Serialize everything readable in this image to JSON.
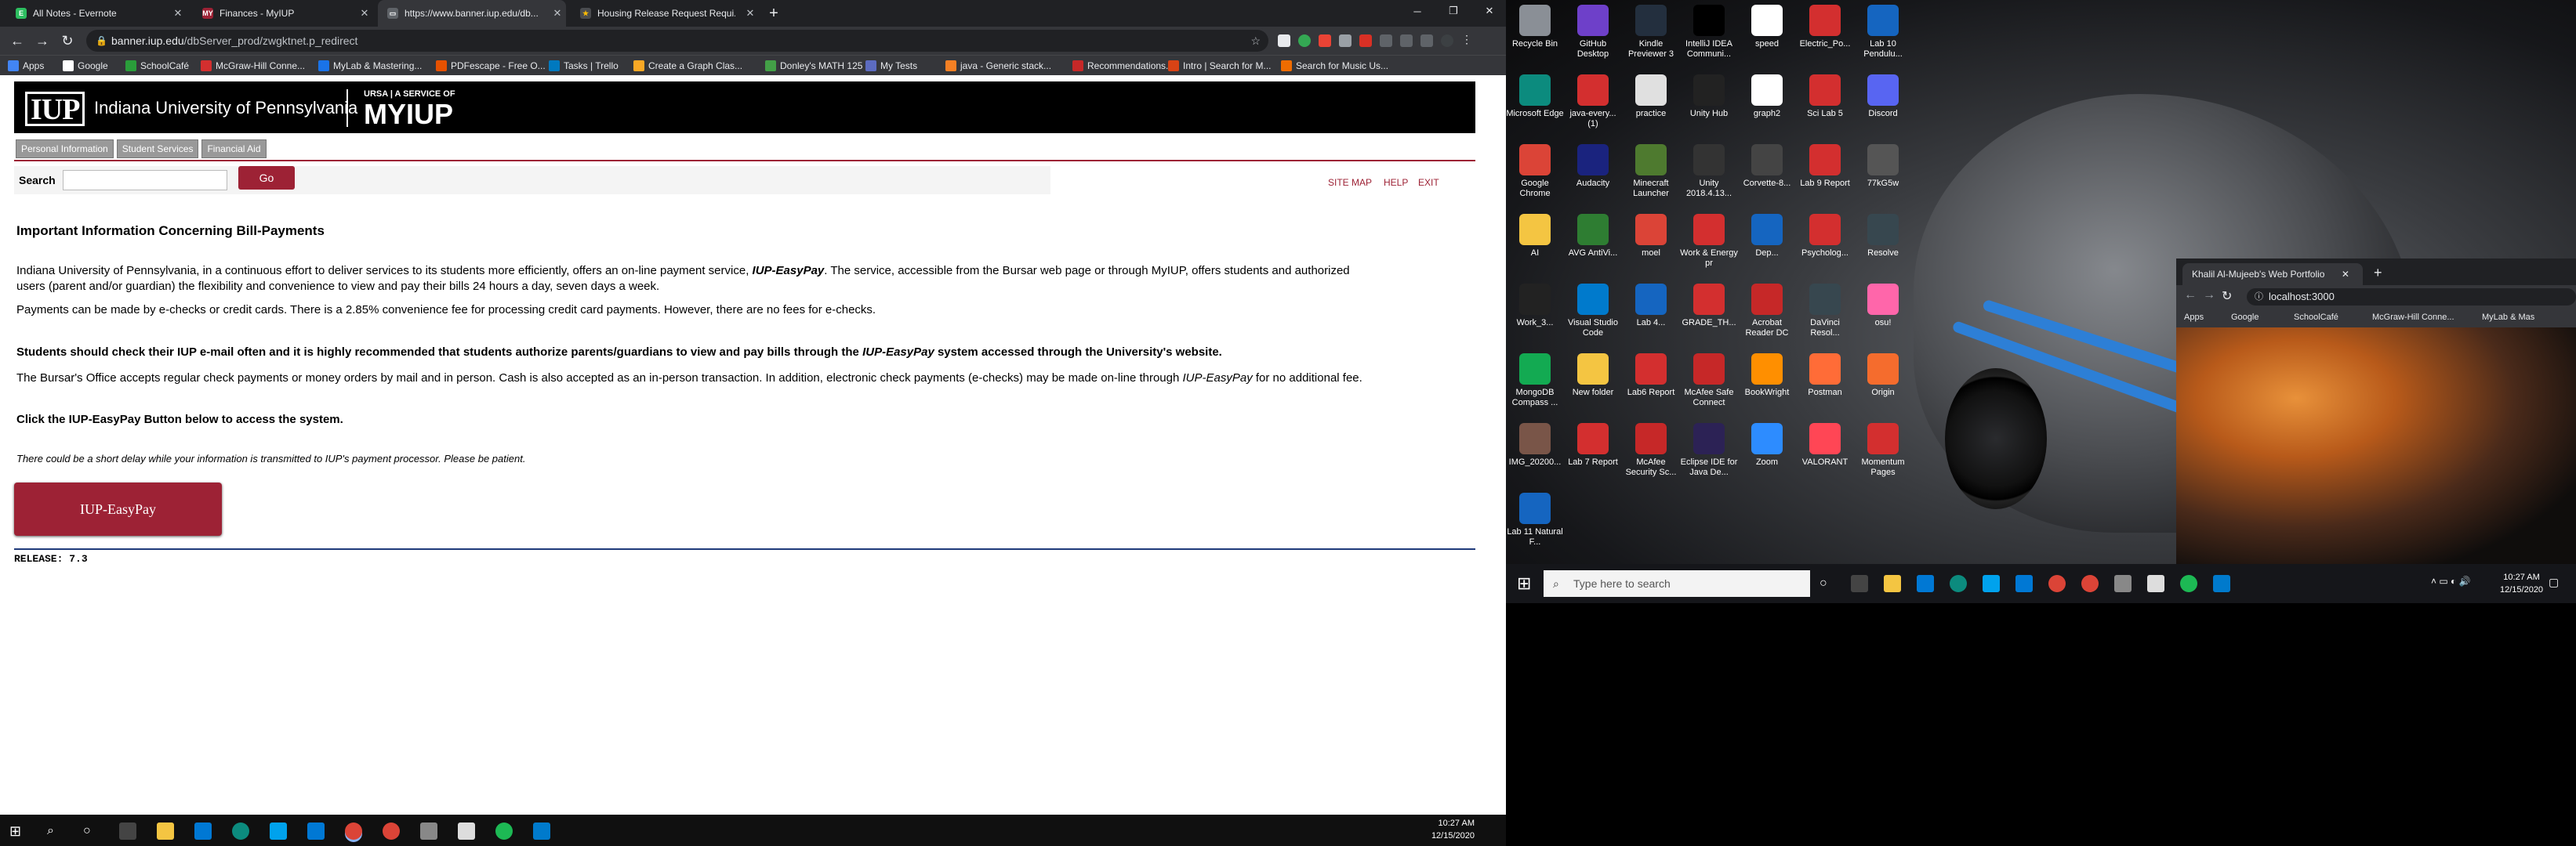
{
  "browser": {
    "tabs": [
      {
        "title": "All Notes - Evernote",
        "fav": "E",
        "fav_color": "#2dbe60"
      },
      {
        "title": "Finances - MyIUP",
        "fav": "MY",
        "fav_color": "#9d2235"
      },
      {
        "title": "https://www.banner.iup.edu/db...",
        "fav": "",
        "fav_color": "#5f6368"
      },
      {
        "title": "Housing Release Request Requi...",
        "fav": "★",
        "fav_color": "#4a4c50"
      }
    ],
    "url_host": "banner.iup.edu",
    "url_path": "/dbServer_prod/zwgktnet.p_redirect",
    "bookmarks": [
      {
        "label": "Apps",
        "color": "#4285f4"
      },
      {
        "label": "Google",
        "color": "#fff"
      },
      {
        "label": "SchoolCafé",
        "color": "#2a9d3a"
      },
      {
        "label": "McGraw-Hill Conne...",
        "color": "#d32f2f"
      },
      {
        "label": "MyLab & Mastering...",
        "color": "#1a73e8"
      },
      {
        "label": "PDFescape - Free O...",
        "color": "#e65100"
      },
      {
        "label": "Tasks | Trello",
        "color": "#0079bf"
      },
      {
        "label": "Create a Graph Clas...",
        "color": "#f9a825"
      },
      {
        "label": "Donley's MATH 125",
        "color": "#43a047"
      },
      {
        "label": "My Tests",
        "color": "#5c6bc0"
      },
      {
        "label": "java - Generic stack...",
        "color": "#f48024"
      },
      {
        "label": "Recommendations...",
        "color": "#c62828"
      },
      {
        "label": "Intro | Search for M...",
        "color": "#d84315"
      },
      {
        "label": "Search for Music Us...",
        "color": "#ef6c00"
      }
    ]
  },
  "page": {
    "brand_name": "Indiana University of Pennsylvania",
    "brand_abbr": "IUP",
    "brand_service": "URSA | A SERVICE OF",
    "brand_myiup": "MYIUP",
    "tabs": [
      "Personal Information",
      "Student Services",
      "Financial Aid"
    ],
    "search_label": "Search",
    "go_label": "Go",
    "toplinks": [
      "SITE MAP",
      "HELP",
      "EXIT"
    ],
    "heading": "Important Information Concerning Bill-Payments",
    "p1_a": "Indiana University of Pennsylvania, in a continuous effort to deliver services to its students more efficiently, offers an on-line payment service, ",
    "p1_b": "IUP-EasyPay",
    "p1_c": ". The service, accessible from the Bursar web page or through MyIUP, offers students and authorized",
    "p1_d": "users (parent and/or guardian) the flexibility and convenience to view and pay their bills 24 hours a day, seven days a week.",
    "p2": "Payments can be made by e-checks or credit cards. There is a 2.85% convenience fee for processing credit card payments. However, there are no fees for e-checks.",
    "p3_a": "Students should check their IUP e-mail often and it is highly recommended that students authorize parents/guardians to view and pay bills through the ",
    "p3_b": "IUP-EasyPay",
    "p3_c": " system accessed through the University's website.",
    "p4_a": "The Bursar's Office accepts regular check payments or money orders by mail and in person. Cash is also accepted as an in-person transaction. In addition, electronic check payments (e-checks) may be made on-line through ",
    "p4_b": "IUP-EasyPay",
    "p4_c": " for no additional fee.",
    "p5": "Click the IUP-EasyPay Button below to access the system.",
    "note": "There could be a short delay while your information is transmitted to IUP's payment processor. Please be patient.",
    "easypay_button": "IUP-EasyPay",
    "release": "RELEASE: 7.3"
  },
  "taskbar": {
    "time": "10:27 AM",
    "date": "12/15/2020"
  },
  "desktop": {
    "icons": [
      {
        "label": "Recycle Bin",
        "color": "#8a8f96"
      },
      {
        "label": "GitHub Desktop",
        "color": "#6e40c9"
      },
      {
        "label": "Kindle Previewer 3",
        "color": "#232f3e"
      },
      {
        "label": "IntelliJ IDEA Communi...",
        "color": "#000"
      },
      {
        "label": "speed",
        "color": "#fff"
      },
      {
        "label": "Electric_Po...",
        "color": "#d32f2f"
      },
      {
        "label": "Lab 10 Pendulu...",
        "color": "#1565c0"
      },
      {
        "label": "Microsoft Edge",
        "color": "#0c8b7e"
      },
      {
        "label": "java-every... (1)",
        "color": "#d32f2f"
      },
      {
        "label": "practice",
        "color": "#e0e0e0"
      },
      {
        "label": "Unity Hub",
        "color": "#222"
      },
      {
        "label": "graph2",
        "color": "#fff"
      },
      {
        "label": "Sci Lab 5",
        "color": "#d32f2f"
      },
      {
        "label": "Discord",
        "color": "#5865f2"
      },
      {
        "label": "Google Chrome",
        "color": "#db4437"
      },
      {
        "label": "Audacity",
        "color": "#1a237e"
      },
      {
        "label": "Minecraft Launcher",
        "color": "#4e7a2f"
      },
      {
        "label": "Unity 2018.4.13...",
        "color": "#333"
      },
      {
        "label": "Corvette-8...",
        "color": "#444"
      },
      {
        "label": "Lab 9 Report",
        "color": "#d32f2f"
      },
      {
        "label": "77kG5w",
        "color": "#555"
      },
      {
        "label": "AI",
        "color": "#f4c542"
      },
      {
        "label": "AVG AntiVi...",
        "color": "#2e7d32"
      },
      {
        "label": "moel",
        "color": "#db4437"
      },
      {
        "label": "Work & Energy pr",
        "color": "#d32f2f"
      },
      {
        "label": "Dep...",
        "color": "#1565c0"
      },
      {
        "label": "Psycholog...",
        "color": "#d32f2f"
      },
      {
        "label": "Resolve",
        "color": "#37474f"
      },
      {
        "label": "Work_3...",
        "color": "#222"
      },
      {
        "label": "Visual Studio Code",
        "color": "#007acc"
      },
      {
        "label": "Lab 4...",
        "color": "#1565c0"
      },
      {
        "label": "GRADE_TH...",
        "color": "#d32f2f"
      },
      {
        "label": "Acrobat Reader DC",
        "color": "#c62828"
      },
      {
        "label": "DaVinci Resol...",
        "color": "#37474f"
      },
      {
        "label": "osu!",
        "color": "#ff66aa"
      },
      {
        "label": "MongoDB Compass ...",
        "color": "#13aa52"
      },
      {
        "label": "New folder",
        "color": "#f4c542"
      },
      {
        "label": "Lab6 Report",
        "color": "#d32f2f"
      },
      {
        "label": "McAfee Safe Connect",
        "color": "#c62828"
      },
      {
        "label": "BookWright",
        "color": "#ff8f00"
      },
      {
        "label": "Postman",
        "color": "#ff6c37"
      },
      {
        "label": "Origin",
        "color": "#f56c2d"
      },
      {
        "label": "IMG_20200...",
        "color": "#795548"
      },
      {
        "label": "Lab 7 Report",
        "color": "#d32f2f"
      },
      {
        "label": "McAfee Security Sc...",
        "color": "#c62828"
      },
      {
        "label": "Eclipse IDE for Java De...",
        "color": "#2c2255"
      },
      {
        "label": "Zoom",
        "color": "#2d8cff"
      },
      {
        "label": "VALORANT",
        "color": "#ff4655"
      },
      {
        "label": "Momentum Pages",
        "color": "#d32f2f"
      },
      {
        "label": "Lab 11 Natural F...",
        "color": "#1565c0"
      }
    ],
    "mini_browser": {
      "tab_title": "Khalil Al-Mujeeb's Web Portfolio",
      "url": "localhost:3000",
      "bookmarks": [
        "Apps",
        "Google",
        "SchoolCafé",
        "McGraw-Hill Conne...",
        "MyLab & Mas"
      ]
    },
    "search_placeholder": "Type here to search",
    "time": "10:27 AM",
    "date": "12/15/2020"
  }
}
